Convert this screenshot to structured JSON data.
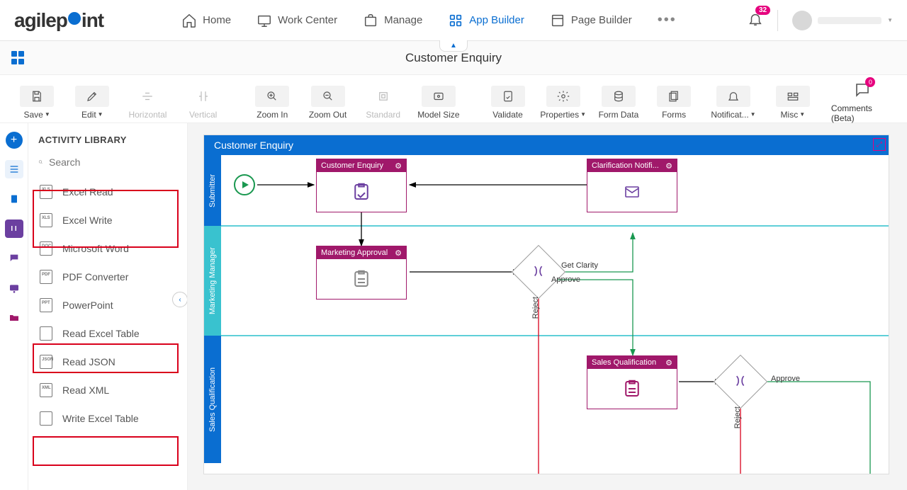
{
  "nav": {
    "logo_a": "agilep",
    "logo_b": "int",
    "items": [
      {
        "label": "Home"
      },
      {
        "label": "Work Center"
      },
      {
        "label": "Manage"
      },
      {
        "label": "App Builder",
        "active": true
      },
      {
        "label": "Page Builder"
      }
    ],
    "notification_count": "32"
  },
  "subheader": {
    "title": "Customer Enquiry"
  },
  "toolbar": {
    "save": "Save",
    "edit": "Edit",
    "horizontal": "Horizontal",
    "vertical": "Vertical",
    "zoom_in": "Zoom In",
    "zoom_out": "Zoom Out",
    "standard": "Standard",
    "model_size": "Model Size",
    "validate": "Validate",
    "properties": "Properties",
    "form_data": "Form Data",
    "forms": "Forms",
    "notifications": "Notificat...",
    "misc": "Misc",
    "comments": "Comments (Beta)",
    "comments_count": "0"
  },
  "sidebar": {
    "title": "ACTIVITY LIBRARY",
    "search_placeholder": "Search",
    "items": [
      {
        "label": "Excel Read",
        "tag": "XLS"
      },
      {
        "label": "Excel Write",
        "tag": "XLS"
      },
      {
        "label": "Microsoft Word",
        "tag": "DOC"
      },
      {
        "label": "PDF Converter",
        "tag": "PDF"
      },
      {
        "label": "PowerPoint",
        "tag": "PPT"
      },
      {
        "label": "Read Excel Table",
        "tag": ""
      },
      {
        "label": "Read JSON",
        "tag": "JSON"
      },
      {
        "label": "Read XML",
        "tag": "XML"
      },
      {
        "label": "Write Excel Table",
        "tag": ""
      }
    ]
  },
  "canvas": {
    "title": "Customer Enquiry",
    "lanes": [
      {
        "label": "Submitter",
        "color": "#0a6ed1"
      },
      {
        "label": "Marketing Manager",
        "color": "#39c2cf"
      },
      {
        "label": "Sales Qualification",
        "color": "#0a6ed1"
      }
    ],
    "activities": {
      "customer_enquiry": "Customer Enquiry",
      "clarification": "Clarification Notifi...",
      "marketing_approval": "Marketing Approval",
      "sales_qualification": "Sales Qualification"
    },
    "edges": {
      "get_clarity": "Get Clarity",
      "approve": "Approve",
      "reject": "Reject",
      "approve2": "Approve"
    }
  }
}
